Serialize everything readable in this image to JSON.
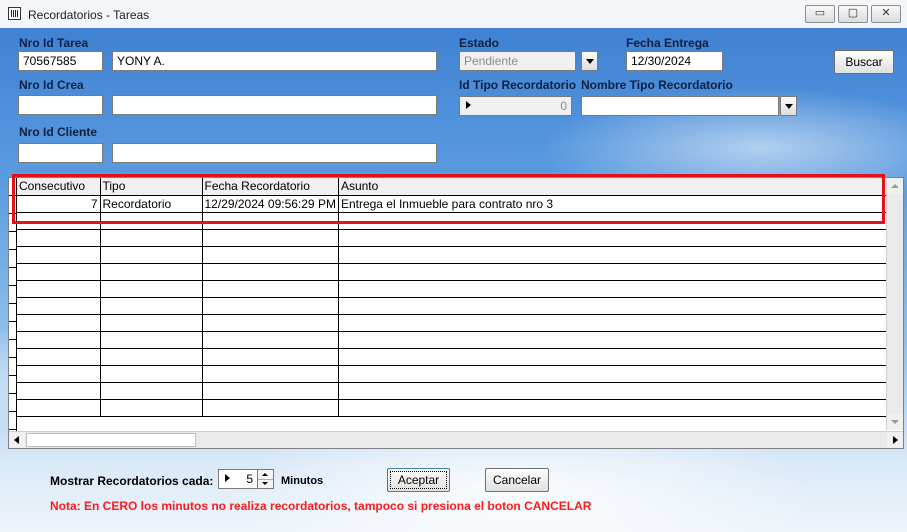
{
  "window": {
    "title": "Recordatorios - Tareas",
    "minimize_glyph": "▭",
    "maximize_glyph": "▢",
    "close_glyph": "✕"
  },
  "form": {
    "nro_id_tarea_label": "Nro Id Tarea",
    "nro_id_tarea_value": "70567585",
    "tarea_nombre_value": "YONY A.",
    "nro_id_crea_label": "Nro Id Crea",
    "nro_id_crea_value": "",
    "crea_nombre_value": "",
    "nro_id_cliente_label": "Nro Id Cliente",
    "nro_id_cliente_value": "",
    "cliente_nombre_value": "",
    "estado_label": "Estado",
    "estado_value": "Pendiente",
    "fecha_entrega_label": "Fecha Entrega",
    "fecha_entrega_value": "12/30/2024",
    "id_tipo_label": "Id Tipo Recordatorio",
    "id_tipo_value": "0",
    "nombre_tipo_label": "Nombre Tipo Recordatorio",
    "nombre_tipo_value": "",
    "buscar_label": "Buscar"
  },
  "grid": {
    "columns": [
      "Consecutivo",
      "Tipo",
      "Fecha Recordatorio",
      "Asunto"
    ],
    "rows": [
      [
        "7",
        "Recordatorio",
        "12/29/2024 09:56:29 PM",
        "Entrega el Inmueble para contrato nro 3"
      ]
    ]
  },
  "footer": {
    "mostrar_label": "Mostrar Recordatorios cada:",
    "minutos_value": "5",
    "minutos_label": "Minutos",
    "aceptar_label": "Aceptar",
    "cancelar_label": "Cancelar",
    "nota": "Nota: En CERO los minutos no realiza recordatorios, tampoco si presiona el boton CANCELAR"
  },
  "colors": {
    "highlight": "#e3111b",
    "nota": "#ff1a1a"
  }
}
